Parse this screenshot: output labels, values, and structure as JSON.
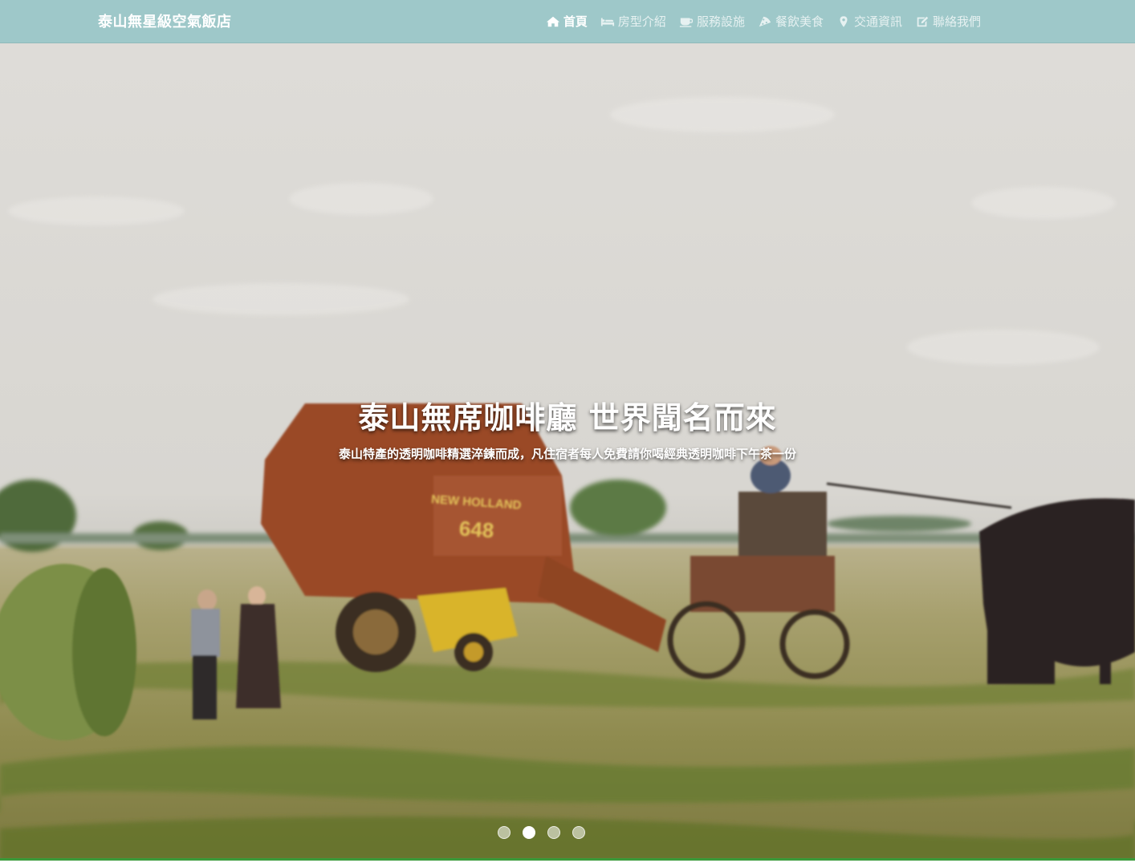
{
  "navbar": {
    "brand": "泰山無星級空氣飯店",
    "items": [
      {
        "label": "首頁",
        "icon": "home-icon",
        "active": true
      },
      {
        "label": "房型介紹",
        "icon": "bed-icon",
        "active": false
      },
      {
        "label": "服務設施",
        "icon": "coffee-icon",
        "active": false
      },
      {
        "label": "餐飲美食",
        "icon": "pizza-icon",
        "active": false
      },
      {
        "label": "交通資訊",
        "icon": "map-marker-icon",
        "active": false
      },
      {
        "label": "聯絡我們",
        "icon": "edit-icon",
        "active": false
      }
    ],
    "background_color": "#9ec8c9"
  },
  "carousel": {
    "title": "泰山無席咖啡廳 世界聞名而來",
    "subtitle": "泰山特產的透明咖啡精選淬鍊而成，凡住宿者每人免費請你喝經典透明咖啡下午茶一份",
    "slide_count": 4,
    "active_slide": 2,
    "image_text": {
      "brand_on_baler": "NEW HOLLAND",
      "model_on_baler": "648"
    }
  }
}
